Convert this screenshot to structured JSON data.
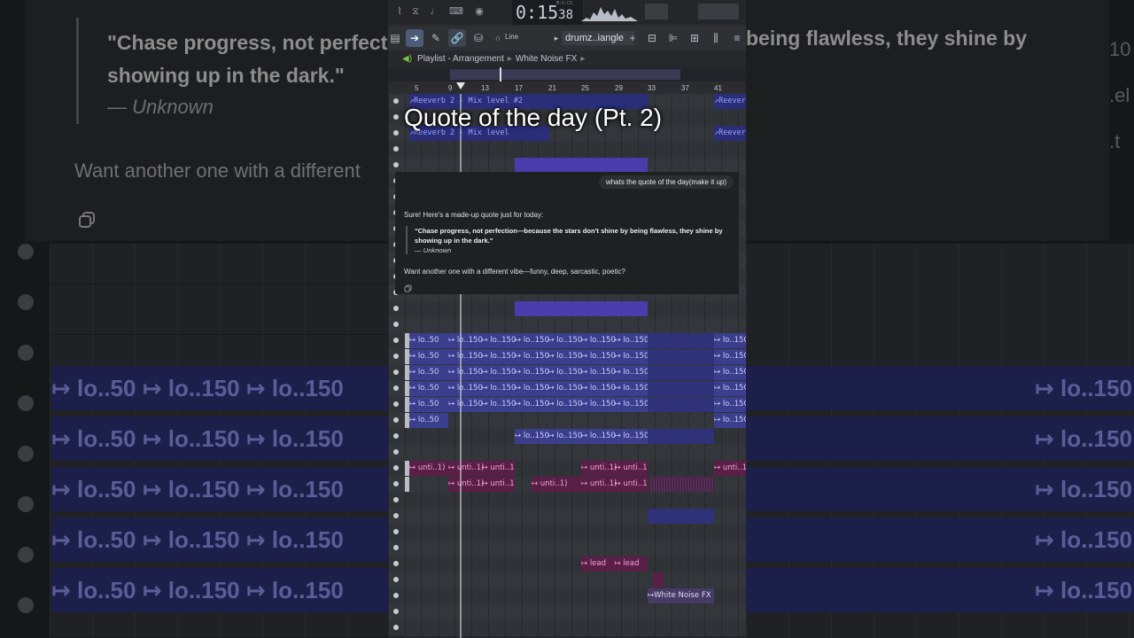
{
  "overlay": {
    "title": "Quote of the day (Pt. 2)"
  },
  "chat": {
    "user_message": "whats the quote of the day(make it up)",
    "assistant_intro": "Sure! Here's a made-up quote just for today:",
    "quote_text": "\"Chase progress, not perfection—because the stars don't shine by being flawless, they shine by showing up in the dark.\"",
    "quote_author": "— Unknown",
    "follow_up": "Want another one with a different vibe—funny, deep, sarcastic, poetic?",
    "copy_icon": "copy-icon"
  },
  "background": {
    "left_quote": "\"Chase progress, not perfectio\nshowing up in the dark.\"",
    "left_author": "— Unknown",
    "left_want": "Want another one with a different",
    "right_quote": "being flawless, they shine by",
    "right_edge": [
      "10",
      ".el",
      ".t"
    ],
    "clip_label_left": "↦ lo..50  ↦ lo..150 ↦ lo..150",
    "clip_label_right": "↦ lo..150"
  },
  "daw": {
    "time_main": "0:15",
    "time_ms": "38",
    "time_label": "M:S:CS",
    "toolbar": {
      "snap_label": "Line",
      "pattern_name": "drumz..iangle",
      "add_label": "+"
    },
    "breadcrumb": [
      "Playlist - Arrangement",
      "White Noise FX"
    ],
    "ruler_marks": [
      "5",
      "9",
      "13",
      "17",
      "21",
      "25",
      "29",
      "33",
      "37",
      "41"
    ],
    "clip_labels": {
      "reverb2": "↗Reeverb 2 - Mix level #2",
      "reverb1": "↗Reeverb 2 - Mix level",
      "reverb_right": "↗Reever",
      "lo50": "↦ lo..50",
      "lo150": "↦ lo..150",
      "unti": "↦ unti..1)",
      "lead": "↦ lead",
      "white_noise": "↦White Noise FX"
    }
  },
  "colors": {
    "accent": "#4b5b78",
    "clip_blue": "#3b3e8c",
    "clip_pink": "#5a1f47",
    "speaker": "#76c442"
  }
}
